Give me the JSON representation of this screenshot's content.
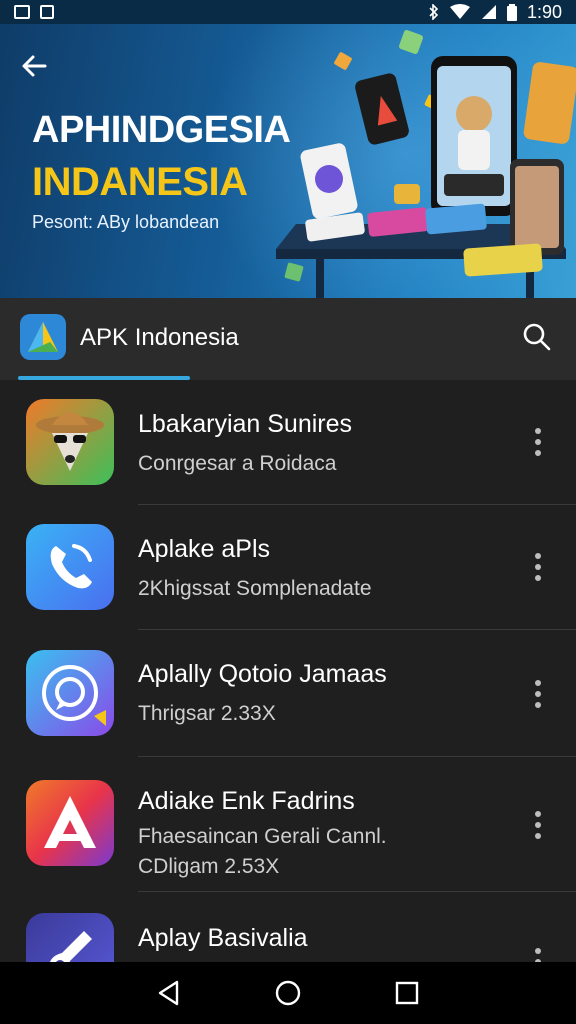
{
  "status_bar": {
    "time": "1:90",
    "icons": [
      "screenshot-icon",
      "notification-icon",
      "bluetooth-icon",
      "wifi-icon",
      "signal-icon",
      "battery-icon"
    ]
  },
  "hero": {
    "title_line1": "APHINDGESIA",
    "title_line2": "INDANESIA",
    "subtitle": "Pesont: ABy lobandean",
    "back_icon": "arrow-left-icon",
    "colors": {
      "title1": "#ffffff",
      "title2": "#f5c518",
      "background": "#155b95"
    }
  },
  "app_bar": {
    "title": "APK Indonesia",
    "logo_icon": "apk-indonesia-logo-icon",
    "search_icon": "search-icon",
    "accent": "#35a8e0"
  },
  "apps": [
    {
      "title": "Lbakaryian Sunires",
      "subtitle": "Conrgesar a Roidaca",
      "subtitle2": "",
      "icon": "fox-cowboy-app-icon"
    },
    {
      "title": "Aplake aPls",
      "subtitle": "2Khigssat Somplenadate",
      "subtitle2": "",
      "icon": "phone-call-app-icon"
    },
    {
      "title": "Aplally Qotoio Jamaas",
      "subtitle": "Thrigsar 2.33X",
      "subtitle2": "",
      "icon": "chat-bubble-app-icon"
    },
    {
      "title": "Adiake Enk Fadrins",
      "subtitle": "Fhaesaincan Gerali Cannl.",
      "subtitle2": "CDligam 2.53X",
      "icon": "letter-a-app-icon"
    },
    {
      "title": "Aplay Basivalia",
      "subtitle": "",
      "subtitle2": "",
      "icon": "guitar-app-icon"
    }
  ],
  "nav_bar": {
    "back": "back-triangle-icon",
    "home": "home-circle-icon",
    "recents": "recents-square-icon"
  }
}
